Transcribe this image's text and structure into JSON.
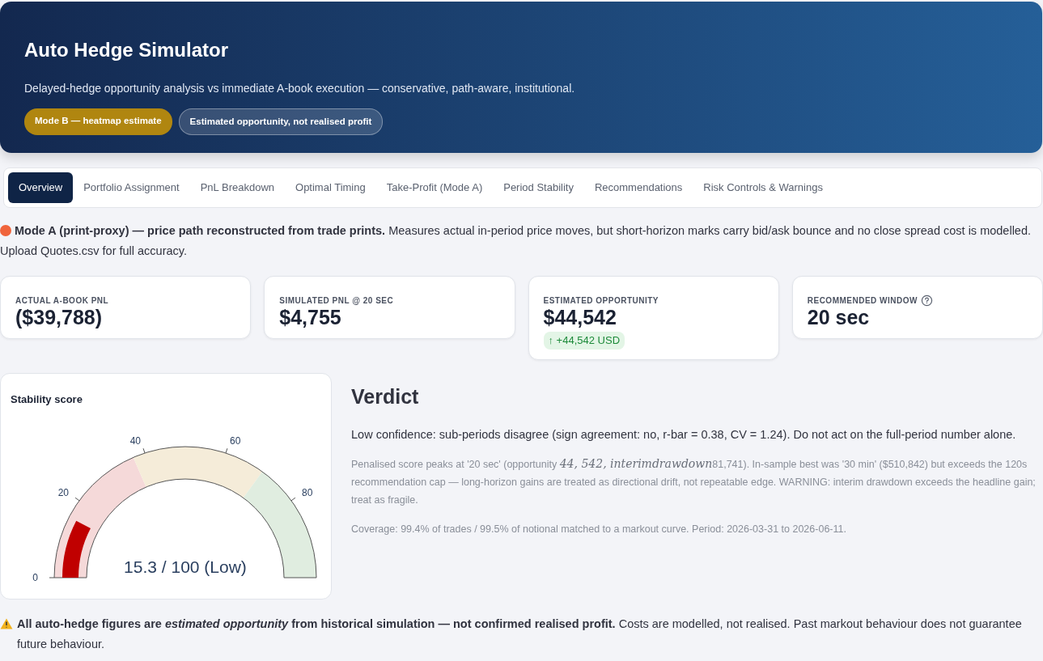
{
  "header": {
    "title": "Auto Hedge Simulator",
    "subtitle": "Delayed-hedge opportunity analysis vs immediate A-book execution — conservative, path-aware, institutional.",
    "badges": [
      {
        "label": "Mode B — heatmap estimate",
        "kind": "mode"
      },
      {
        "label": "Estimated opportunity, not realised profit",
        "kind": "note"
      }
    ]
  },
  "tabs": [
    {
      "label": "Overview",
      "selected": true
    },
    {
      "label": "Portfolio Assignment",
      "selected": false
    },
    {
      "label": "PnL Breakdown",
      "selected": false
    },
    {
      "label": "Optimal Timing",
      "selected": false
    },
    {
      "label": "Take-Profit (Mode A)",
      "selected": false
    },
    {
      "label": "Period Stability",
      "selected": false
    },
    {
      "label": "Recommendations",
      "selected": false
    },
    {
      "label": "Risk Controls & Warnings",
      "selected": false
    }
  ],
  "mode_notice": {
    "color": "#f0643c",
    "text": "**Mode A (print-proxy) — price path reconstructed from trade prints.** Measures actual in-period price moves, but short-horizon marks carry bid/ask bounce and no close spread cost is modelled. Upload Quotes.csv for full accuracy."
  },
  "metrics": [
    {
      "label": "ACTUAL A-BOOK PNL",
      "value": "($39,788)",
      "help": false
    },
    {
      "label": "SIMULATED PNL @ 20 SEC",
      "value": "$4,755",
      "help": false
    },
    {
      "label": "ESTIMATED OPPORTUNITY",
      "value": "$44,542",
      "delta": "↑ +44,542 USD",
      "help": false
    },
    {
      "label": "RECOMMENDED WINDOW",
      "value": "20 sec",
      "help": true
    }
  ],
  "stability": {
    "title": "Stability score",
    "readout": "15.3 / 100 (Low)",
    "ticks": [
      "0",
      "20",
      "40",
      "60",
      "80"
    ],
    "bands": [
      {
        "color": "#f5d9d9"
      },
      {
        "color": "#f5ecd9"
      },
      {
        "color": "#e0ede0"
      }
    ]
  },
  "verdict": {
    "title": "Verdict",
    "summary": "Low confidence: sub-periods disagree (sign agreement: no, r-bar = 0.38, CV = 1.24). Do not act on the full-period number alone.",
    "detail": [
      {
        "kind": "plain",
        "text": "Penalised score peaks at '20 sec' (opportunity "
      },
      {
        "kind": "math",
        "text": "44, 542, interimdrawdown"
      },
      {
        "kind": "plain",
        "text": "81,741). In-sample best was '30 min' ($510,842) but exceeds the 120s recommendation cap — long-horizon gains are treated as directional drift, not repeatable edge. WARNING: interim drawdown exceeds the headline gain; treat as fragile."
      }
    ],
    "coverage": "Coverage: 99.4% of trades / 99.5% of notional matched to a markout curve. Period: 2026-03-31 to 2026-06-11."
  },
  "footer_warning": "**All auto-hedge figures are *estimated opportunity* from historical simulation — not confirmed realised profit.** Costs are modelled, not realised. Past markout behaviour does not guarantee future behaviour."
}
